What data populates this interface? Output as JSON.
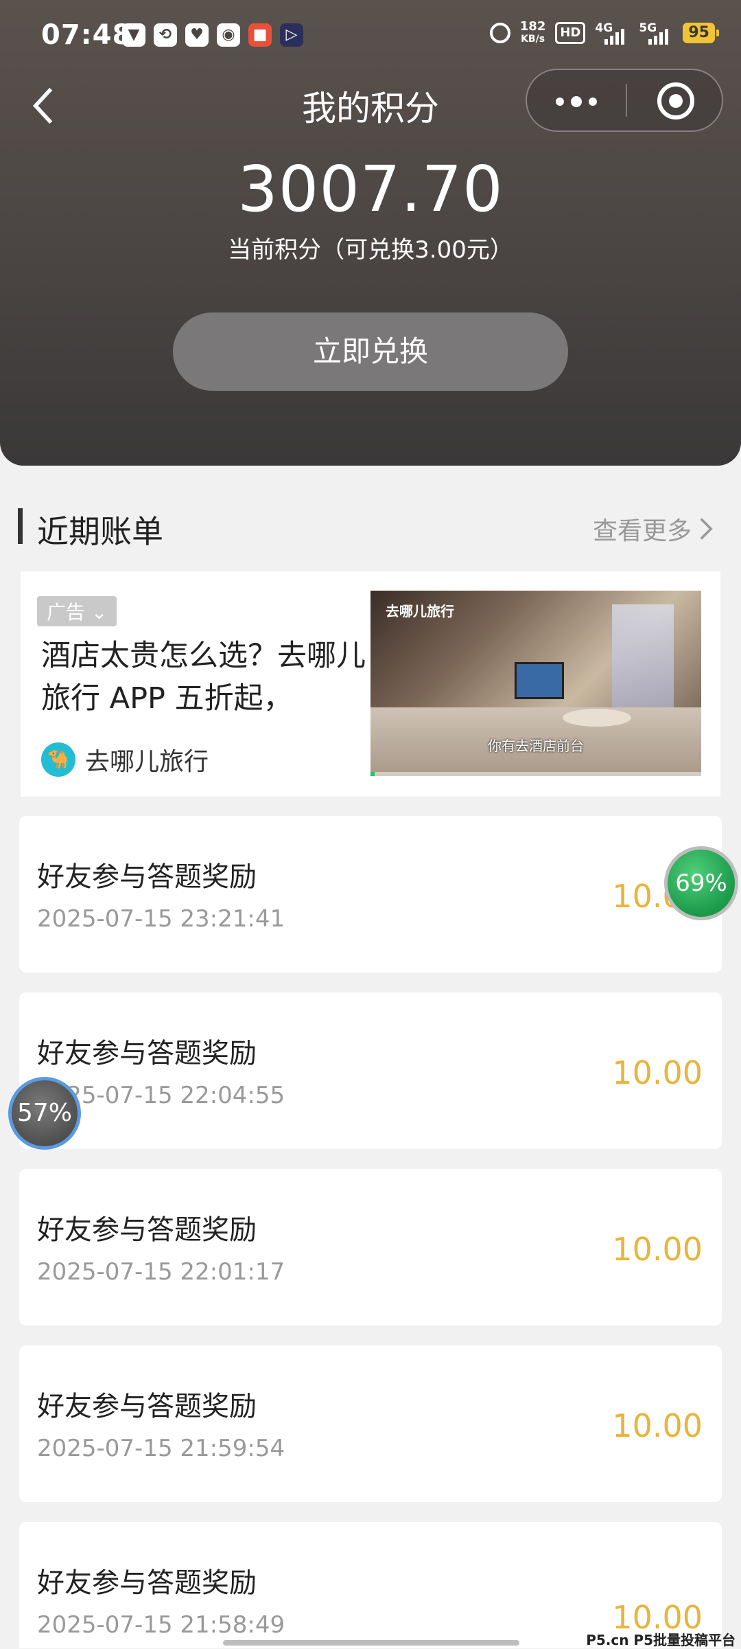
{
  "status_bar": {
    "time": "07:48",
    "left_icons": [
      "shield-icon",
      "refresh-icon",
      "heart-icon",
      "weibo-icon",
      "app-icon",
      "play-icon"
    ],
    "net_speed_value": "182",
    "net_speed_unit": "KB/s",
    "hd_label": "HD",
    "net_4g": "4G",
    "net_5g": "5G",
    "battery": "95"
  },
  "nav": {
    "title": "我的积分"
  },
  "points": {
    "value": "3007.70",
    "subtitle": "当前积分（可兑换3.00元）",
    "exchange_label": "立即兑换"
  },
  "section": {
    "title": "近期账单",
    "view_more": "查看更多"
  },
  "ad": {
    "tag": "广告",
    "headline": "酒店太贵怎么选？去哪儿旅行 APP 五折起，",
    "brand": "去哪儿旅行",
    "image_logo_text": "去哪儿旅行",
    "image_caption": "你有去酒店前台",
    "progress": 0.01
  },
  "records": [
    {
      "title": "好友参与答题奖励",
      "date": "2025-07-15 23:21:41",
      "amount": "10.00"
    },
    {
      "title": "好友参与答题奖励",
      "date": "2025-07-15 22:04:55",
      "amount": "10.00"
    },
    {
      "title": "好友参与答题奖励",
      "date": "2025-07-15 22:01:17",
      "amount": "10.00"
    },
    {
      "title": "好友参与答题奖励",
      "date": "2025-07-15 21:59:54",
      "amount": "10.00"
    },
    {
      "title": "好友参与答题奖励",
      "date": "2025-07-15 21:58:49",
      "amount": "10.00"
    }
  ],
  "floating": {
    "widget_a": "69%",
    "widget_b": "57%"
  },
  "watermark": "P5.cn P5批量投稿平台",
  "colors": {
    "header_bg": "#4a4543",
    "amount": "#e8b43a",
    "page_bg": "#f1f1f1"
  }
}
